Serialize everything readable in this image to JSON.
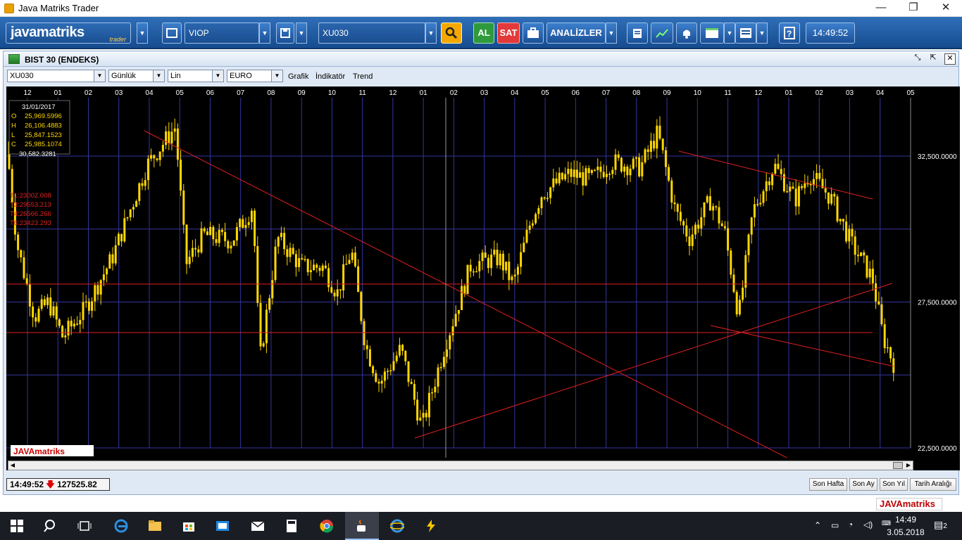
{
  "window": {
    "title": "Java Matriks Trader",
    "controls": [
      "—",
      "❐",
      "✕"
    ]
  },
  "toolbar": {
    "logo_text": "javamatriks",
    "logo_sub": "trader",
    "market": "VIOP",
    "symbol": "XU030",
    "buy_label": "AL",
    "sell_label": "SAT",
    "analysis_label": "ANALİZLER",
    "time": "14:49:52",
    "colors": {
      "buy": "#2e9a3c",
      "sell": "#e23a3a",
      "search": "#f5a800"
    }
  },
  "panel": {
    "title": "BIST 30 (ENDEKS)",
    "selects": {
      "symbol": "XU030",
      "period": "Günlük",
      "scale": "Lin",
      "currency": "EURO"
    },
    "menu": [
      "Grafik",
      "İndikatör",
      "Trend"
    ]
  },
  "chart_data": {
    "type": "candlestick",
    "x_ticks": [
      "12",
      "01",
      "02",
      "03",
      "04",
      "05",
      "06",
      "07",
      "08",
      "09",
      "10",
      "11",
      "12",
      "01",
      "02",
      "03",
      "04",
      "05",
      "06",
      "07",
      "08",
      "09",
      "10",
      "11",
      "12",
      "01",
      "02",
      "03",
      "04",
      "05"
    ],
    "y_ticks": [
      "32,500.0000",
      "27,500.0000",
      "22,500.0000"
    ],
    "ylim": [
      22500,
      34500
    ],
    "tooltip": {
      "date": "31/01/2017",
      "O": "25,969.5996",
      "H": "26,106.4883",
      "L": "25,847.1523",
      "C": "25,985.1074",
      "extra": "30,582.3281"
    },
    "trend_labels": [
      "T1:23002.008",
      "T3:29553.213",
      "T4:26566.266",
      "T6:23423.293"
    ],
    "watermark": "JAVAmatriks",
    "grid": true,
    "colors": {
      "bg": "#000000",
      "candle": "#ffd800",
      "trend": "#e02020",
      "grid": "#3535a0"
    }
  },
  "status": {
    "time": "14:49:52",
    "value": "127525.82"
  },
  "range_buttons": [
    "Son Hafta",
    "Son Ay",
    "Son Yıl",
    "Tarih Aralığı"
  ],
  "bottom_logo": "JAVAmatriks",
  "taskbar": {
    "time": "14:49",
    "date": "3.05.2018",
    "notif": "2"
  }
}
